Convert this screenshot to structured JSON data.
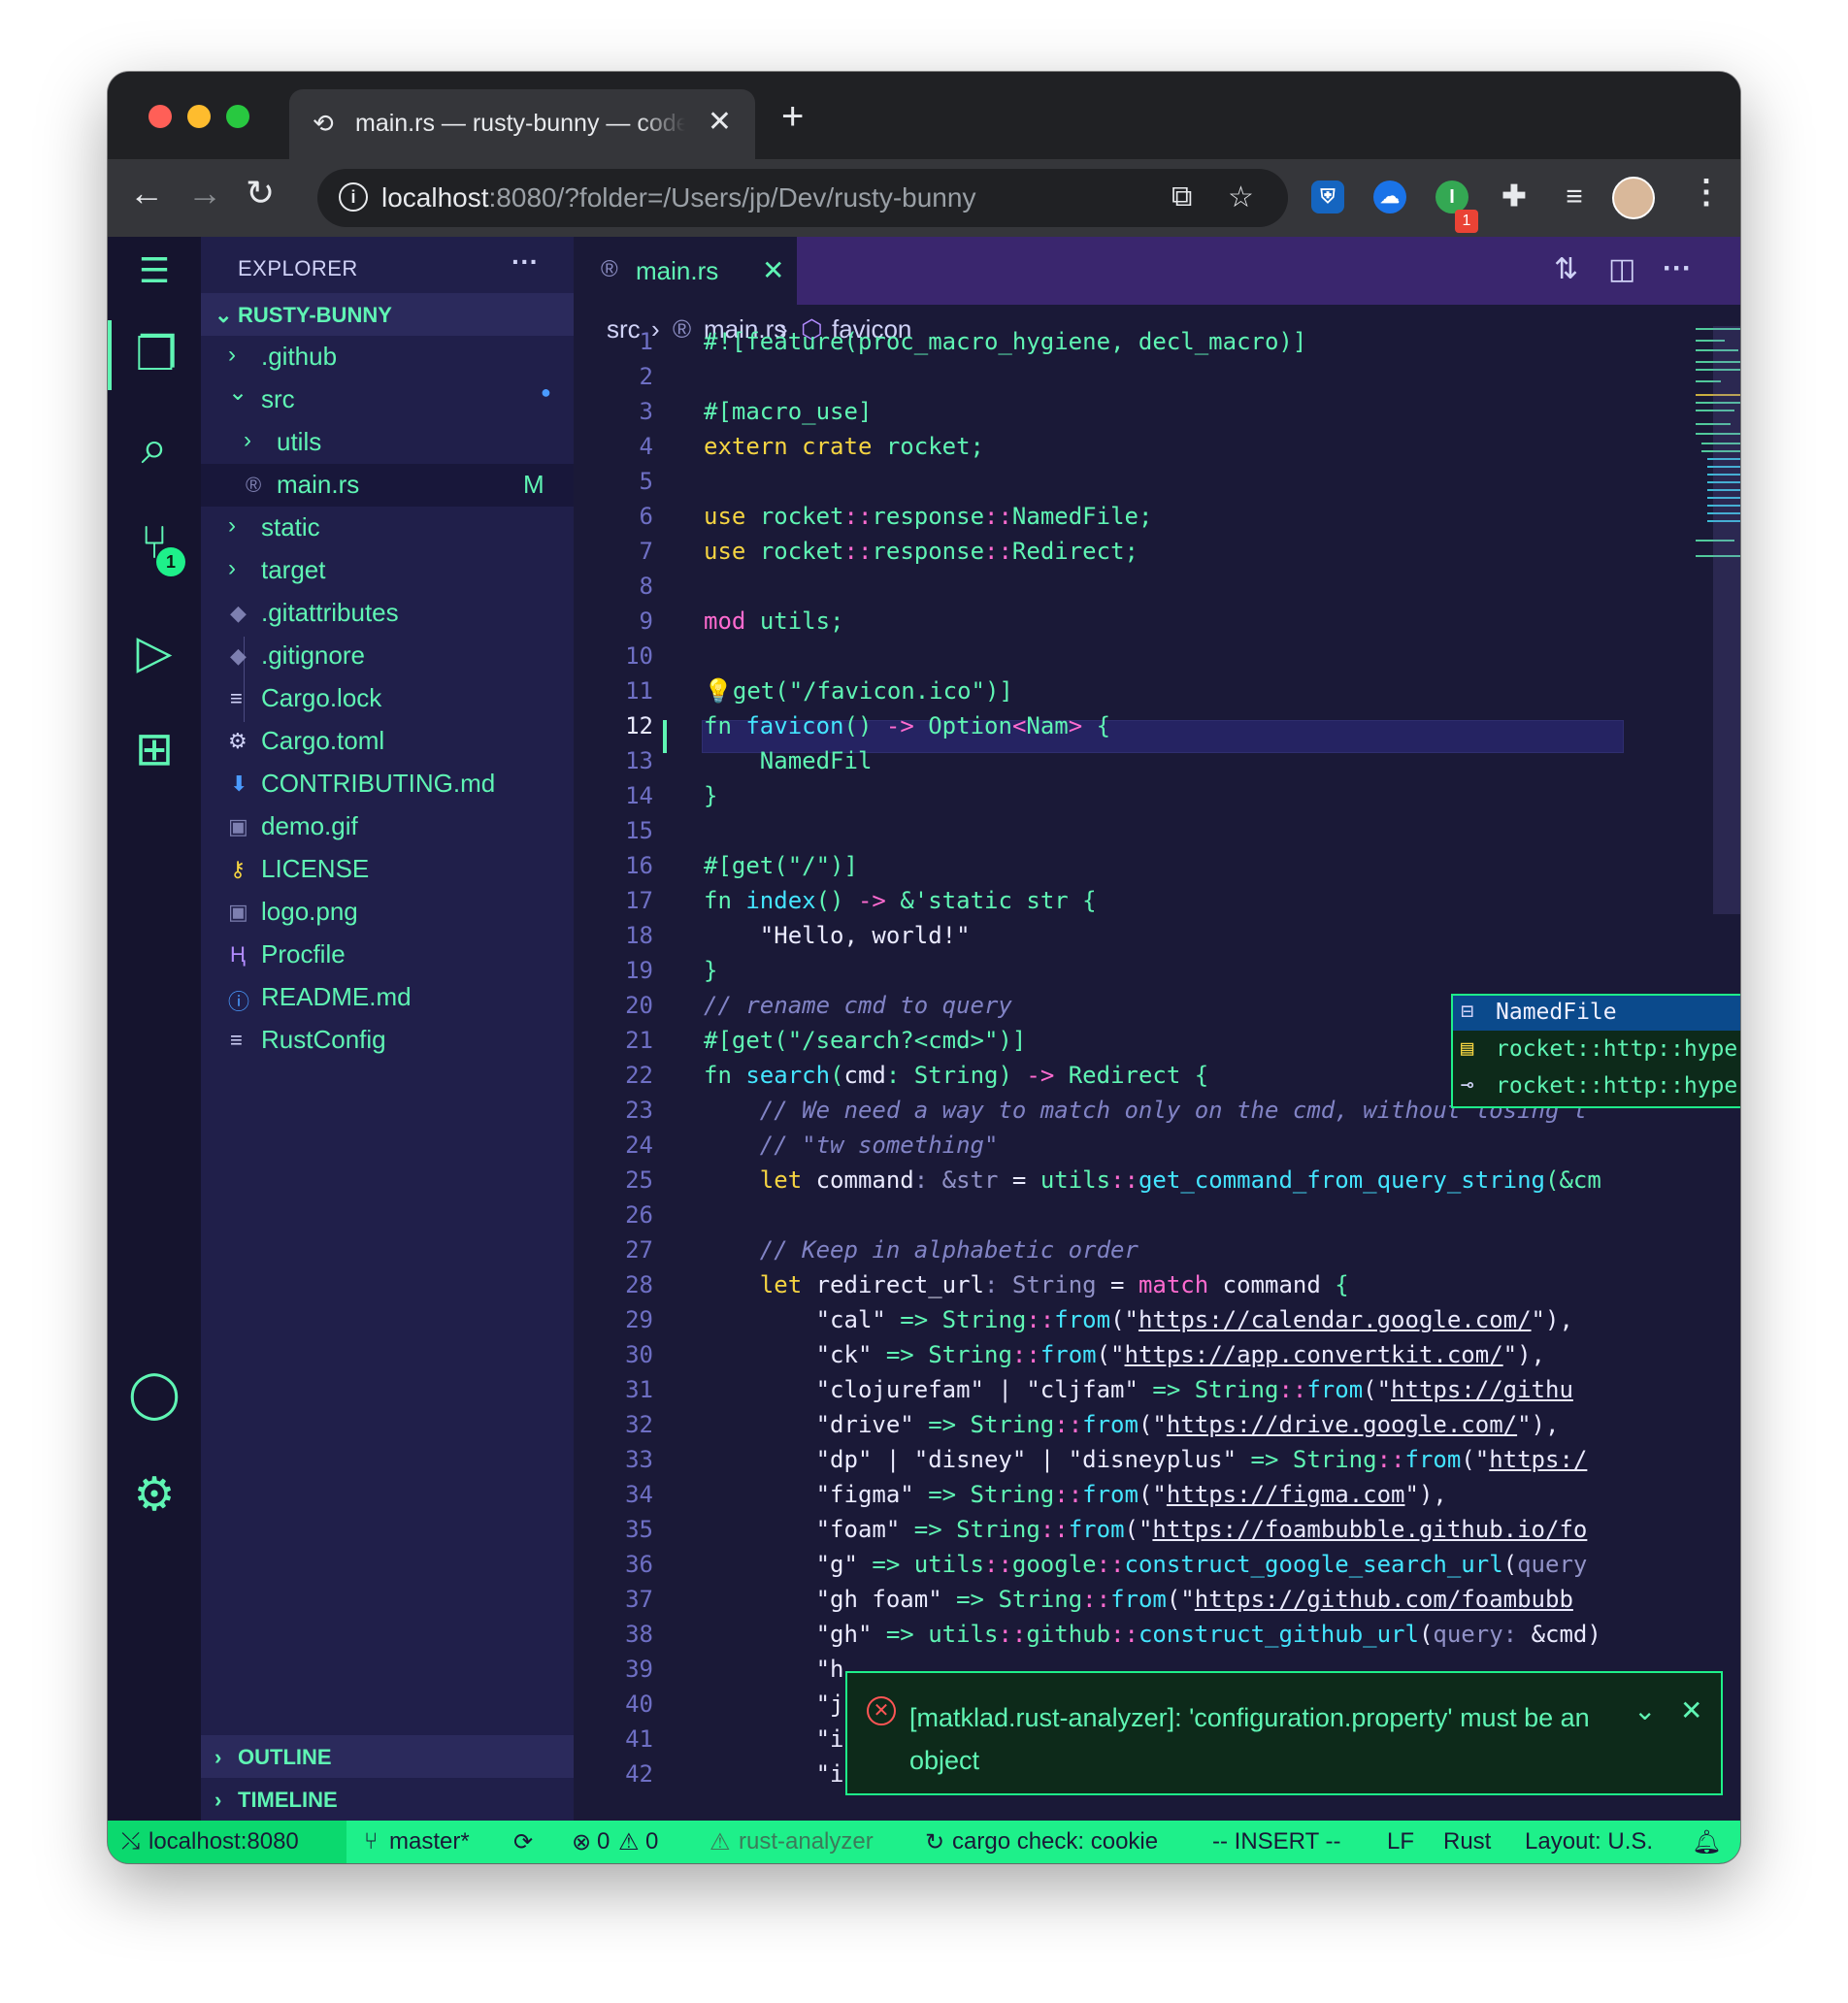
{
  "browser": {
    "tab_title": "main.rs — rusty-bunny — code-server",
    "new_tab": "+",
    "tab_close": "✕",
    "url_host": "localhost",
    "url_rest": ":8080/?folder=/Users/jp/Dev/rusty-bunny",
    "ext_badge": "1"
  },
  "sidebar": {
    "title": "EXPLORER",
    "more": "···",
    "root": "RUSTY-BUNNY",
    "items": [
      {
        "label": ".github",
        "chev": "›"
      },
      {
        "label": "src",
        "chev": "⌄"
      },
      {
        "label": "utils",
        "chev": "›"
      },
      {
        "label": "main.rs",
        "mark": "M"
      },
      {
        "label": "static",
        "chev": "›"
      },
      {
        "label": "target",
        "chev": "›"
      },
      {
        "label": ".gitattributes"
      },
      {
        "label": ".gitignore"
      },
      {
        "label": "Cargo.lock"
      },
      {
        "label": "Cargo.toml"
      },
      {
        "label": "CONTRIBUTING.md"
      },
      {
        "label": "demo.gif"
      },
      {
        "label": "LICENSE"
      },
      {
        "label": "logo.png"
      },
      {
        "label": "Procfile"
      },
      {
        "label": "README.md"
      },
      {
        "label": "RustConfig"
      }
    ],
    "src_dot": "●",
    "outline": "OUTLINE",
    "timeline": "TIMELINE",
    "activity_badge": "1"
  },
  "editor": {
    "tab": "main.rs",
    "tab_close": "✕",
    "breadcrumb": [
      "src",
      "main.rs",
      "favicon"
    ],
    "line_numbers": [
      "1",
      "2",
      "3",
      "4",
      "5",
      "6",
      "7",
      "8",
      "9",
      "10",
      "11",
      "12",
      "13",
      "14",
      "15",
      "16",
      "17",
      "18",
      "19",
      "20",
      "21",
      "22",
      "23",
      "24",
      "25",
      "26",
      "27",
      "28",
      "29",
      "30",
      "31",
      "32",
      "33",
      "34",
      "35",
      "36",
      "37",
      "38",
      "39",
      "40",
      "41",
      "42"
    ],
    "suggestions": [
      "NamedFile",
      "rocket::http::hyper::header::ProtocolName",
      "rocket::http::hyper::net::NetworkStream"
    ]
  },
  "notification": {
    "message": "[matklad.rust-analyzer]: 'configuration.property' must be an object",
    "expand": "⌄",
    "close": "✕"
  },
  "status": {
    "remote": "localhost:8080",
    "branch": "master*",
    "errors": "0",
    "warnings": "0",
    "analyzer": "rust-analyzer",
    "cargo": "cargo check: cookie",
    "mode": "-- INSERT --",
    "eol": "LF",
    "language": "Rust",
    "layout": "Layout: U.S."
  },
  "colors": {
    "accent": "#5ff5b4",
    "status_bg": "#1ef08a",
    "editor_bg": "#1a1937",
    "sidebar_bg": "#201f4a",
    "tabs_bg": "#3a266e"
  },
  "icons": [
    "copy-files-icon",
    "search-icon",
    "source-control-icon",
    "run-debug-icon",
    "extensions-icon",
    "account-icon",
    "settings-gear-icon"
  ]
}
